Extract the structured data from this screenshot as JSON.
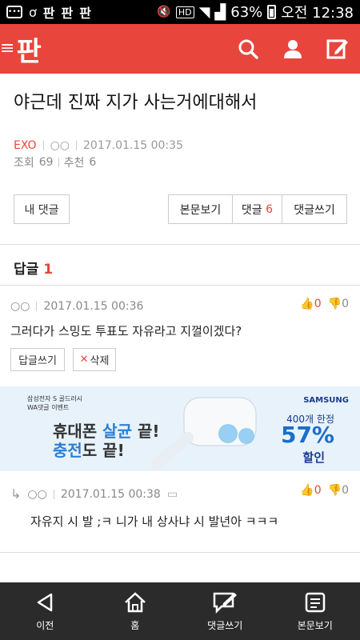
{
  "statusbar": {
    "apps": [
      "판",
      "판",
      "판"
    ],
    "hd": "HD",
    "battery": "63%",
    "time": "오전 12:38"
  },
  "appbar": {
    "logo": "판",
    "menu": "≡"
  },
  "post": {
    "title": "야근데 진짜 지가 사는거에대해서",
    "author": "EXO",
    "nickname": "○○",
    "date": "2017.01.15 00:35",
    "views_label": "조회",
    "views": "69",
    "recommend_label": "추천",
    "recommend": "6"
  },
  "buttons": {
    "my_comments": "내 댓글",
    "view_post": "본문보기",
    "comments": "댓글",
    "comments_count": "6",
    "write_comment": "댓글쓰기"
  },
  "replies": {
    "label": "답글",
    "count": "1"
  },
  "comment1": {
    "nickname": "○○",
    "date": "2017.01.15 00:36",
    "text": "그러다가 스밍도 투표도 자유라고 지껄이겠다?",
    "up": "0",
    "down": "0",
    "reply_btn": "답글쓰기",
    "delete_btn": "삭제"
  },
  "ad": {
    "brandline": "삼성전자 S 골드러시",
    "event": "WA댓글 이벤트",
    "line1a": "휴대폰 ",
    "line1b": "살균",
    "line1c": " 끝!",
    "line2a": "충전",
    "line2b": "도 끝!",
    "samsung": "SAMSUNG",
    "limit": "400개 한정",
    "percent": "57%",
    "sale": "할인"
  },
  "comment2": {
    "nickname": "○○",
    "date": "2017.01.15 00:38",
    "text": "자유지 시 발 ;ㅋ 니가 내 상사냐 시 발년아 ㅋㅋㅋ",
    "up": "0",
    "down": "0"
  },
  "nav": {
    "prev": "이전",
    "home": "홈",
    "write": "댓글쓰기",
    "view": "본문보기"
  }
}
